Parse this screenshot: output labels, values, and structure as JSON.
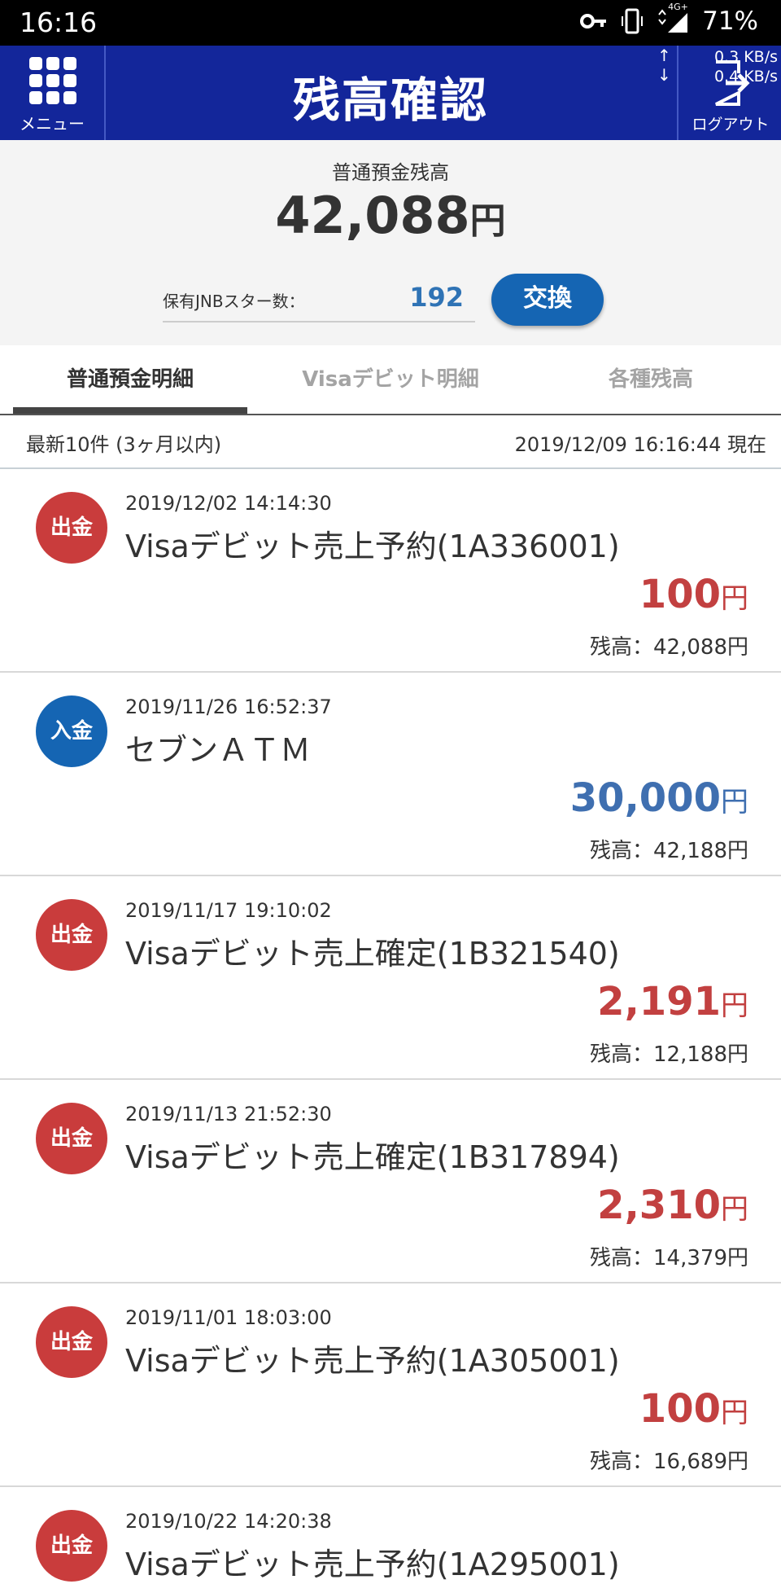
{
  "status_bar": {
    "time": "16:16",
    "battery": "71%",
    "network_label": "4G+"
  },
  "header": {
    "menu_label": "メニュー",
    "title": "残高確認",
    "net_speed_up": "0.3 KB/s",
    "net_speed_down": "0.4 KB/s",
    "logout_label": "ログアウト"
  },
  "balance": {
    "label": "普通預金残高",
    "amount": "42,088",
    "unit": "円",
    "star_label": "保有JNBスター数：",
    "star_value": "192",
    "exchange_label": "交換"
  },
  "tabs": [
    {
      "label": "普通預金明細",
      "active": true
    },
    {
      "label": "Visaデビット明細",
      "active": false
    },
    {
      "label": "各種残高",
      "active": false
    }
  ],
  "info": {
    "left": "最新10件 (3ヶ月以内)",
    "right": "2019/12/09 16:16:44 現在"
  },
  "transactions": [
    {
      "type": "out",
      "badge": "出金",
      "date": "2019/12/02 14:14:30",
      "title": "Visaデビット売上予約(1A336001)",
      "amount": "100",
      "unit": "円",
      "balance": "残高：42,088円"
    },
    {
      "type": "in",
      "badge": "入金",
      "date": "2019/11/26 16:52:37",
      "title": "セブンＡＴＭ",
      "amount": "30,000",
      "unit": "円",
      "balance": "残高：42,188円"
    },
    {
      "type": "out",
      "badge": "出金",
      "date": "2019/11/17 19:10:02",
      "title": "Visaデビット売上確定(1B321540)",
      "amount": "2,191",
      "unit": "円",
      "balance": "残高：12,188円"
    },
    {
      "type": "out",
      "badge": "出金",
      "date": "2019/11/13 21:52:30",
      "title": "Visaデビット売上確定(1B317894)",
      "amount": "2,310",
      "unit": "円",
      "balance": "残高：14,379円"
    },
    {
      "type": "out",
      "badge": "出金",
      "date": "2019/11/01 18:03:00",
      "title": "Visaデビット売上予約(1A305001)",
      "amount": "100",
      "unit": "円",
      "balance": "残高：16,689円"
    },
    {
      "type": "out",
      "badge": "出金",
      "date": "2019/10/22 14:20:38",
      "title": "Visaデビット売上予約(1A295001)",
      "amount": "",
      "unit": "",
      "balance": ""
    }
  ],
  "colors": {
    "header_bg": "#13269a",
    "withdrawal": "#c93c3c",
    "deposit": "#1565b3"
  }
}
